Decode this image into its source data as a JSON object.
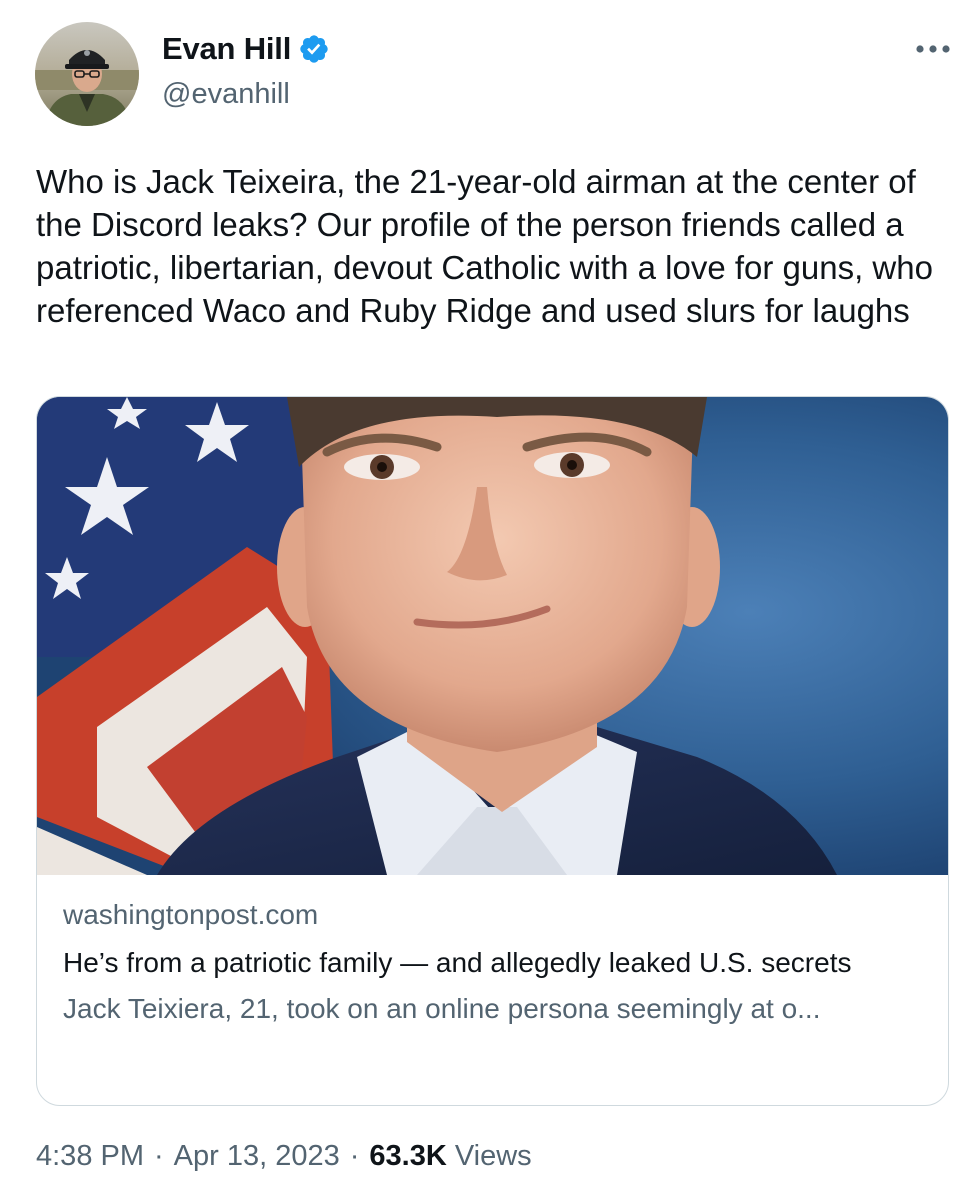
{
  "author": {
    "display_name": "Evan Hill",
    "handle": "@evanhill",
    "verified": true,
    "verified_color": "#1d9bf0"
  },
  "more_icon": "ellipsis-horizontal-icon",
  "tweet": {
    "text": "Who is Jack Teixeira, the 21-year-old airman at the center of the Discord leaks? Our profile of the person friends called a patriotic, libertarian, devout Catholic with a love for guns, who referenced Waco and Ruby Ridge and used slurs for laughs"
  },
  "card": {
    "domain": "washingtonpost.com",
    "title": "He’s from a patriotic family — and allegedly leaked U.S. secrets",
    "description": "Jack Teixiera, 21, took on an online persona seemingly at o..."
  },
  "footer": {
    "time": "4:38 PM",
    "separator": "·",
    "date": "Apr 13, 2023",
    "views_count": "63.3K",
    "views_label": "Views"
  },
  "colors": {
    "text_primary": "#0f1419",
    "text_secondary": "#536471",
    "border": "#cfd9de"
  }
}
